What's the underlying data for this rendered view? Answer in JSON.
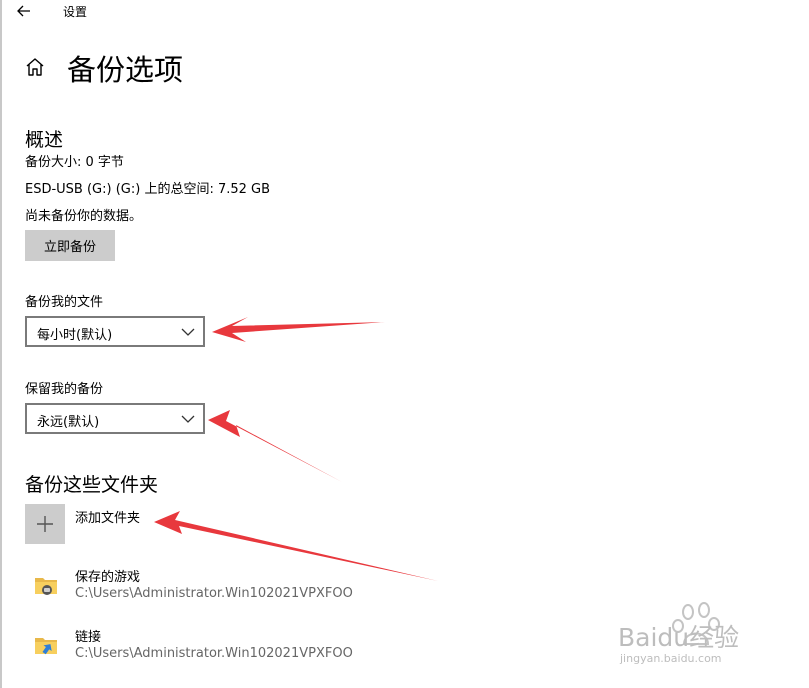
{
  "window": {
    "title": "设置"
  },
  "icons": {
    "back": "arrow-left-icon",
    "home": "home-icon",
    "add": "plus-icon",
    "dropdown": "chevron-down-icon",
    "folder": "folder-icon"
  },
  "page": {
    "title": "备份选项"
  },
  "overview": {
    "heading": "概述",
    "backup_size": "备份大小: 0 字节",
    "total_space": "ESD-USB (G:) (G:) 上的总空间: 7.52 GB",
    "status": "尚未备份你的数据。",
    "backup_now_label": "立即备份"
  },
  "backup_frequency": {
    "label": "备份我的文件",
    "value": "每小时(默认)"
  },
  "keep_backups": {
    "label": "保留我的备份",
    "value": "永远(默认)"
  },
  "folders": {
    "heading": "备份这些文件夹",
    "add_label": "添加文件夹",
    "items": [
      {
        "name": "保存的游戏",
        "path": "C:\\Users\\Administrator.Win102021VPXFOO"
      },
      {
        "name": "链接",
        "path": "C:\\Users\\Administrator.Win102021VPXFOO"
      }
    ]
  },
  "watermark": {
    "brand": "Baidu经验",
    "url": "jingyan.baidu.com"
  },
  "colors": {
    "button_bg": "#cccccc",
    "annotation_arrow": "#e8383d",
    "secondary_text": "#666666"
  }
}
